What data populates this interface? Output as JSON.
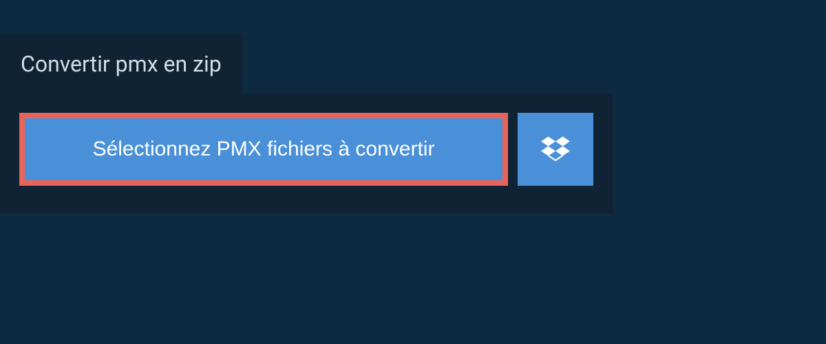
{
  "header": {
    "tab_label": "Convertir pmx en zip"
  },
  "upload": {
    "select_label": "Sélectionnez PMX fichiers à convertir"
  },
  "colors": {
    "background": "#0e2a40",
    "panel": "#102335",
    "button_primary": "#4a90d9",
    "highlight_border": "#e8645a",
    "text_light": "#d5dde3",
    "text_white": "#ffffff"
  }
}
